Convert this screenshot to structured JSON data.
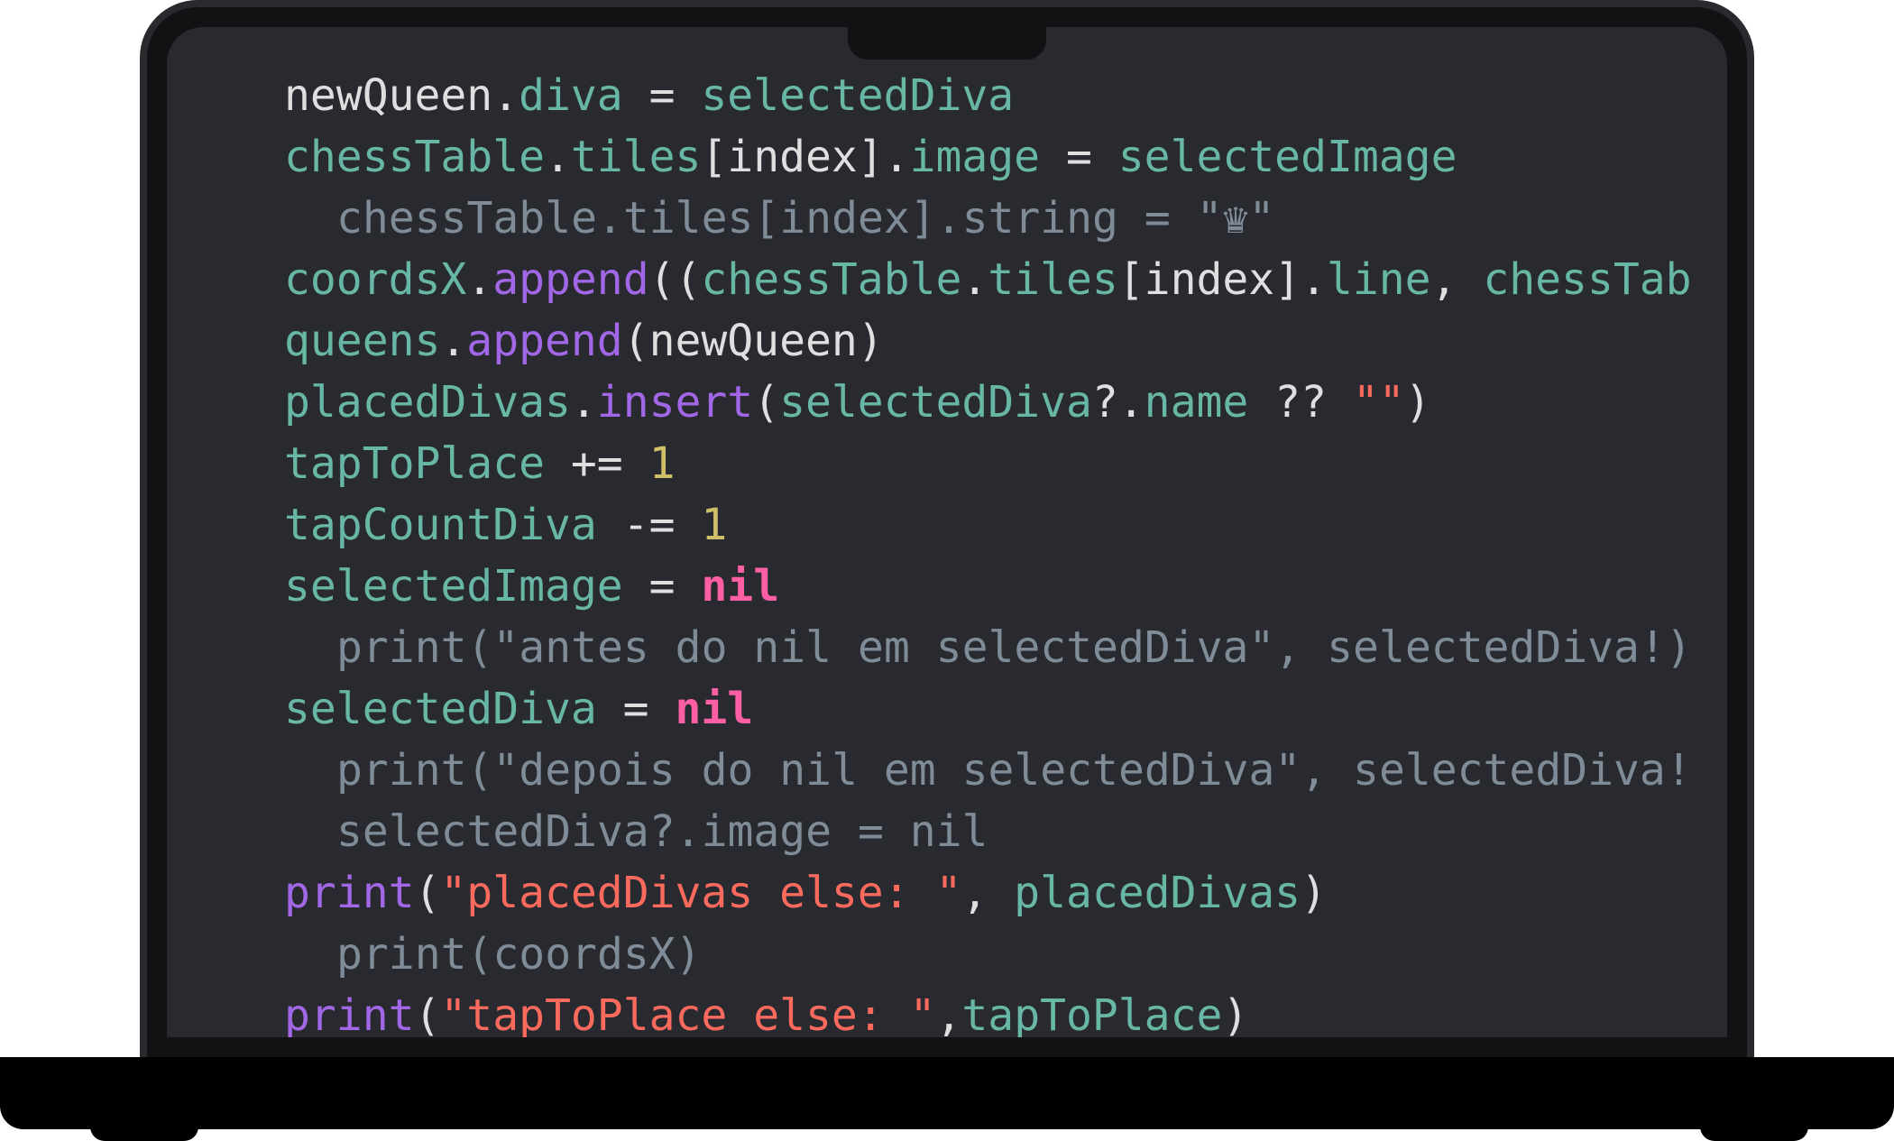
{
  "editor": {
    "colors": {
      "background": "#292a30",
      "text": "#dfdfe0",
      "property": "#67b7a4",
      "function": "#a167e6",
      "string": "#fc6a5d",
      "number": "#d0bf69",
      "keyword": "#fc5fa3",
      "comment": "#7f8c98"
    },
    "lines": [
      {
        "tokens": [
          {
            "text": "newQueen",
            "type": "plain"
          },
          {
            "text": ".",
            "type": "plain"
          },
          {
            "text": "diva",
            "type": "prop"
          },
          {
            "text": " = ",
            "type": "plain"
          },
          {
            "text": "selectedDiva",
            "type": "prop"
          }
        ]
      },
      {
        "tokens": [
          {
            "text": "chessTable",
            "type": "prop"
          },
          {
            "text": ".",
            "type": "plain"
          },
          {
            "text": "tiles",
            "type": "prop"
          },
          {
            "text": "[index].",
            "type": "plain"
          },
          {
            "text": "image",
            "type": "prop"
          },
          {
            "text": " = ",
            "type": "plain"
          },
          {
            "text": "selectedImage",
            "type": "prop"
          }
        ]
      },
      {
        "tokens": [
          {
            "text": "chessTable.tiles[index].string = \"♛\"",
            "type": "cmt"
          }
        ]
      },
      {
        "tokens": [
          {
            "text": "coordsX",
            "type": "prop"
          },
          {
            "text": ".",
            "type": "plain"
          },
          {
            "text": "append",
            "type": "fn"
          },
          {
            "text": "((",
            "type": "plain"
          },
          {
            "text": "chessTable",
            "type": "prop"
          },
          {
            "text": ".",
            "type": "plain"
          },
          {
            "text": "tiles",
            "type": "prop"
          },
          {
            "text": "[index].",
            "type": "plain"
          },
          {
            "text": "line",
            "type": "prop"
          },
          {
            "text": ", ",
            "type": "plain"
          },
          {
            "text": "chessTab",
            "type": "prop"
          }
        ]
      },
      {
        "tokens": [
          {
            "text": "queens",
            "type": "prop"
          },
          {
            "text": ".",
            "type": "plain"
          },
          {
            "text": "append",
            "type": "fn"
          },
          {
            "text": "(newQueen)",
            "type": "plain"
          }
        ]
      },
      {
        "tokens": [
          {
            "text": "placedDivas",
            "type": "prop"
          },
          {
            "text": ".",
            "type": "plain"
          },
          {
            "text": "insert",
            "type": "fn"
          },
          {
            "text": "(",
            "type": "plain"
          },
          {
            "text": "selectedDiva",
            "type": "prop"
          },
          {
            "text": "?.",
            "type": "plain"
          },
          {
            "text": "name",
            "type": "prop"
          },
          {
            "text": " ?? ",
            "type": "plain"
          },
          {
            "text": "\"\"",
            "type": "str"
          },
          {
            "text": ")",
            "type": "plain"
          }
        ]
      },
      {
        "tokens": [
          {
            "text": "tapToPlace",
            "type": "prop"
          },
          {
            "text": " += ",
            "type": "plain"
          },
          {
            "text": "1",
            "type": "num"
          }
        ]
      },
      {
        "tokens": [
          {
            "text": "tapCountDiva",
            "type": "prop"
          },
          {
            "text": " -= ",
            "type": "plain"
          },
          {
            "text": "1",
            "type": "num"
          }
        ]
      },
      {
        "tokens": [
          {
            "text": "selectedImage",
            "type": "prop"
          },
          {
            "text": " = ",
            "type": "plain"
          },
          {
            "text": "nil",
            "type": "kw"
          }
        ]
      },
      {
        "tokens": [
          {
            "text": "print(\"antes do nil em selectedDiva\", selectedDiva!)",
            "type": "cmt"
          }
        ]
      },
      {
        "tokens": [
          {
            "text": "selectedDiva",
            "type": "prop"
          },
          {
            "text": " = ",
            "type": "plain"
          },
          {
            "text": "nil",
            "type": "kw"
          }
        ]
      },
      {
        "tokens": [
          {
            "text": "print(\"depois do nil em selectedDiva\", selectedDiva!",
            "type": "cmt"
          }
        ]
      },
      {
        "tokens": [
          {
            "text": "selectedDiva?.image = nil",
            "type": "cmt"
          }
        ]
      },
      {
        "tokens": [
          {
            "text": "print",
            "type": "fn"
          },
          {
            "text": "(",
            "type": "plain"
          },
          {
            "text": "\"placedDivas else: \"",
            "type": "str"
          },
          {
            "text": ", ",
            "type": "plain"
          },
          {
            "text": "placedDivas",
            "type": "prop"
          },
          {
            "text": ")",
            "type": "plain"
          }
        ]
      },
      {
        "tokens": [
          {
            "text": "print(coordsX)",
            "type": "cmt"
          }
        ]
      },
      {
        "tokens": [
          {
            "text": "print",
            "type": "fn"
          },
          {
            "text": "(",
            "type": "plain"
          },
          {
            "text": "\"tapToPlace else: \"",
            "type": "str"
          },
          {
            "text": ",",
            "type": "plain"
          },
          {
            "text": "tapToPlace",
            "type": "prop"
          },
          {
            "text": ")",
            "type": "plain"
          }
        ]
      }
    ],
    "closing_brace": "}"
  }
}
